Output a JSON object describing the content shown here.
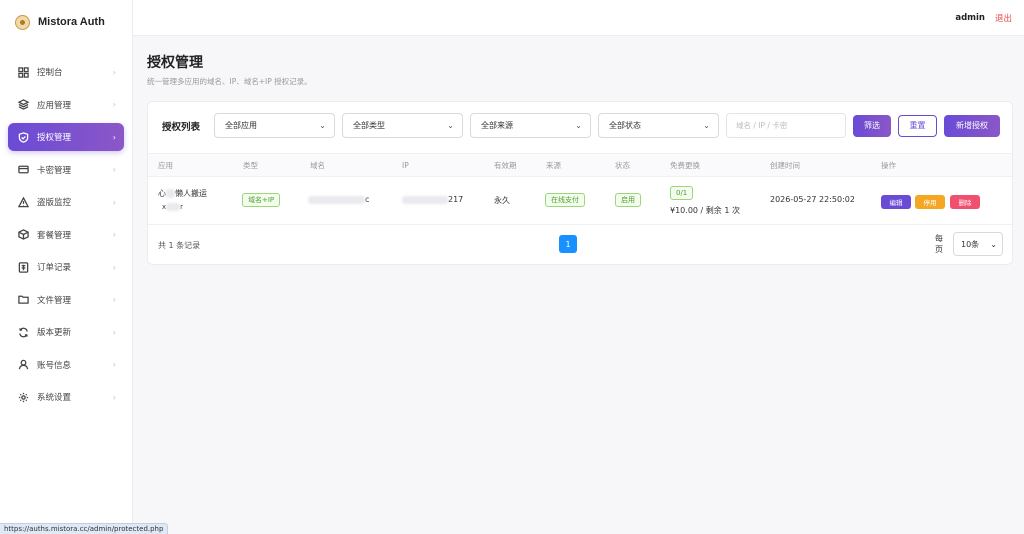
{
  "app": {
    "name": "Mistora Auth"
  },
  "sidebar": {
    "items": [
      {
        "label": "控制台",
        "icon": "dashboard-icon"
      },
      {
        "label": "应用管理",
        "icon": "layers-icon"
      },
      {
        "label": "授权管理",
        "icon": "shield-icon",
        "active": true
      },
      {
        "label": "卡密管理",
        "icon": "card-icon"
      },
      {
        "label": "盗版监控",
        "icon": "warning-icon"
      },
      {
        "label": "套餐管理",
        "icon": "box-icon"
      },
      {
        "label": "订单记录",
        "icon": "receipt-icon"
      },
      {
        "label": "文件管理",
        "icon": "folder-icon"
      },
      {
        "label": "版本更新",
        "icon": "refresh-icon"
      },
      {
        "label": "账号信息",
        "icon": "user-icon"
      },
      {
        "label": "系统设置",
        "icon": "gear-icon"
      }
    ],
    "chevron": "›"
  },
  "topbar": {
    "user": "admin",
    "logout": "退出"
  },
  "page": {
    "title": "授权管理",
    "subtitle": "统一管理多应用的域名、IP、域名+IP 授权记录。"
  },
  "filters": {
    "card_title": "授权列表",
    "app_select": "全部应用",
    "type_select": "全部类型",
    "source_select": "全部来源",
    "status_select": "全部状态",
    "search_placeholder": "域名 / IP / 卡密",
    "filter_button": "筛选",
    "reset_button": "重置",
    "add_button": "新增授权"
  },
  "table": {
    "columns": [
      "应用",
      "类型",
      "域名",
      "IP",
      "有效期",
      "来源",
      "状态",
      "免费更换",
      "创建时间",
      "操作"
    ],
    "rows": [
      {
        "app_line1_prefix": "心",
        "app_line1_suffix": "懒人搬运",
        "app_line2_prefix": "x",
        "app_line2_suffix": "r",
        "type": "域名+IP",
        "domain_suffix": "c",
        "ip_suffix": "217",
        "validity": "永久",
        "source": "在线支付",
        "status": "启用",
        "free_change_badge": "0/1",
        "free_change_text": "¥10.00 / 剩余 1 次",
        "created": "2026-05-27 22:50:02",
        "actions": {
          "edit": "编辑",
          "disable": "停用",
          "delete": "删除"
        }
      }
    ]
  },
  "pagination": {
    "total": "共 1 条记录",
    "current_page": "1",
    "per_label": "每页",
    "per_value": "10条"
  },
  "statusbar": {
    "url": "https://auths.mistora.cc/admin/protected.php"
  },
  "colors": {
    "accent": "#6a4bd6",
    "page_blue": "#1890ff",
    "edit": "#6a4bd6",
    "disable": "#f5a623",
    "delete": "#f0506e",
    "success": "#49a626",
    "logout": "#e34b4b"
  }
}
